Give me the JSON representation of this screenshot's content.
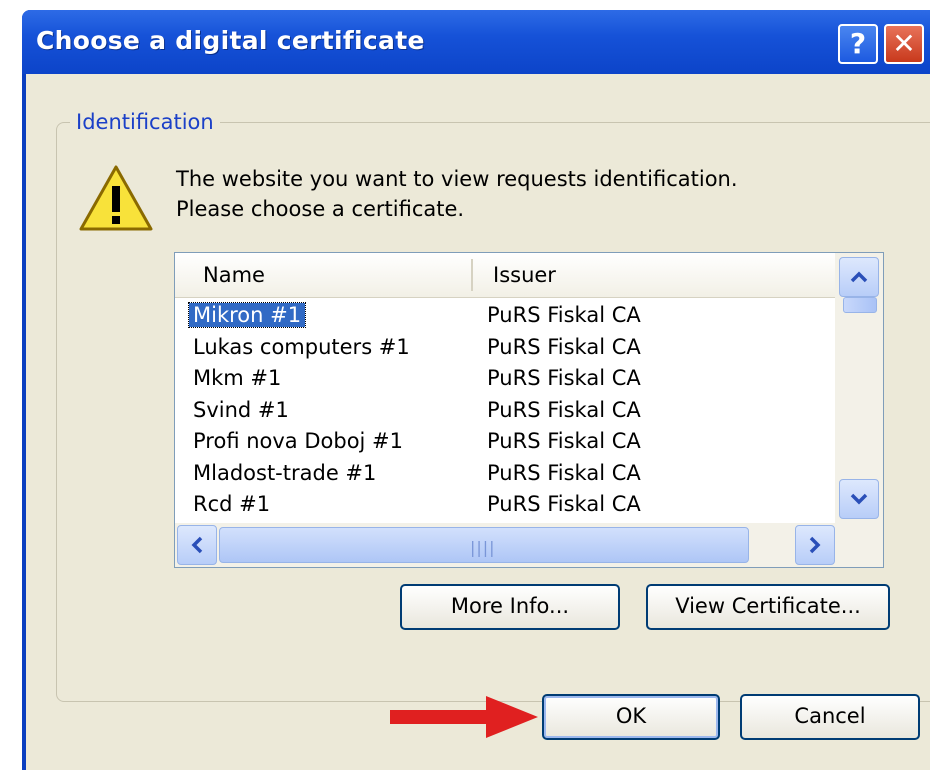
{
  "window": {
    "title": "Choose a digital certificate",
    "help_glyph": "?",
    "close_glyph": "✕"
  },
  "group": {
    "label": "Identification",
    "message_line1": "The website you want to view requests identification.",
    "message_line2": "Please choose a certificate."
  },
  "list": {
    "columns": [
      "Name",
      "Issuer"
    ],
    "rows": [
      {
        "name": "Mikron #1",
        "issuer": "PuRS Fiskal CA",
        "selected": true
      },
      {
        "name": "Lukas computers #1",
        "issuer": "PuRS Fiskal CA"
      },
      {
        "name": "Mkm #1",
        "issuer": "PuRS Fiskal CA"
      },
      {
        "name": "Svind #1",
        "issuer": "PuRS Fiskal CA"
      },
      {
        "name": "Profi nova Doboj #1",
        "issuer": "PuRS Fiskal CA"
      },
      {
        "name": "Mladost-trade #1",
        "issuer": "PuRS Fiskal CA"
      },
      {
        "name": "Rcd #1",
        "issuer": "PuRS Fiskal CA"
      }
    ]
  },
  "buttons": {
    "more_info": "More Info...",
    "view_certificate": "View Certificate...",
    "ok": "OK",
    "cancel": "Cancel"
  },
  "icons": {
    "warning": "warning-triangle-icon",
    "arrow": "red-arrow-icon"
  },
  "colors": {
    "titlebar": "#0c44c9",
    "selection": "#316ac5",
    "arrow": "#e02020"
  }
}
